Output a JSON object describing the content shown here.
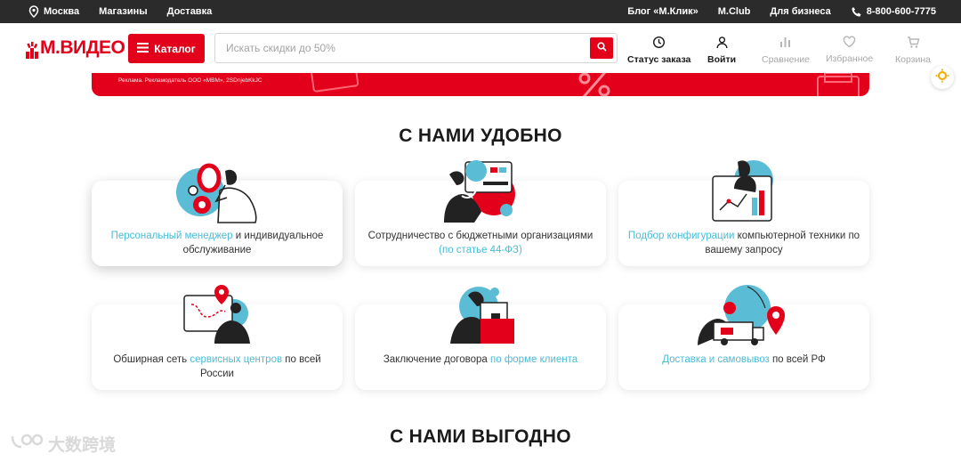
{
  "topbar": {
    "city": "Москва",
    "stores": "Магазины",
    "delivery": "Доставка",
    "blog": "Блог «М.Клик»",
    "club": "M.Club",
    "business": "Для бизнеса",
    "phone": "8-800-600-7775"
  },
  "header": {
    "logo": "М.ВИДЕО",
    "catalog_label": "Каталог",
    "search_placeholder": "Искать скидки до 50%",
    "search_value": "",
    "nav": {
      "order_status": "Статус заказа",
      "login": "Войти",
      "compare": "Сравнение",
      "favorites": "Избранное",
      "cart": "Корзина"
    }
  },
  "banner": {
    "ad_text": "Реклама. Рекламодатель ООО «МВМ», 2SDnjebKkJC"
  },
  "section1": {
    "title": "С НАМИ УДОБНО",
    "cards": [
      {
        "link": "Персональный менеджер",
        "text": " и индивидуальное обслуживание"
      },
      {
        "text": "Сотрудничество с бюджетными организациями ",
        "link": "(по статье 44-ФЗ)"
      },
      {
        "link": "Подбор конфигурации",
        "text": " компьютерной техники по вашему запросу"
      },
      {
        "pre": "Обширная сеть ",
        "link": "сервисных центров",
        "text": " по всей России"
      },
      {
        "pre": "Заключение договора ",
        "link": "по форме клиента"
      },
      {
        "link": "Доставка и самовывоз",
        "text": " по всей РФ"
      }
    ]
  },
  "section2": {
    "title": "С НАМИ ВЫГОДНО"
  },
  "watermark": "大数跨境",
  "colors": {
    "brand_red": "#e3001b",
    "link_blue": "#4dbbd6",
    "topbar_bg": "#2b2b2b",
    "illustration_blue": "#5bbcd6"
  }
}
